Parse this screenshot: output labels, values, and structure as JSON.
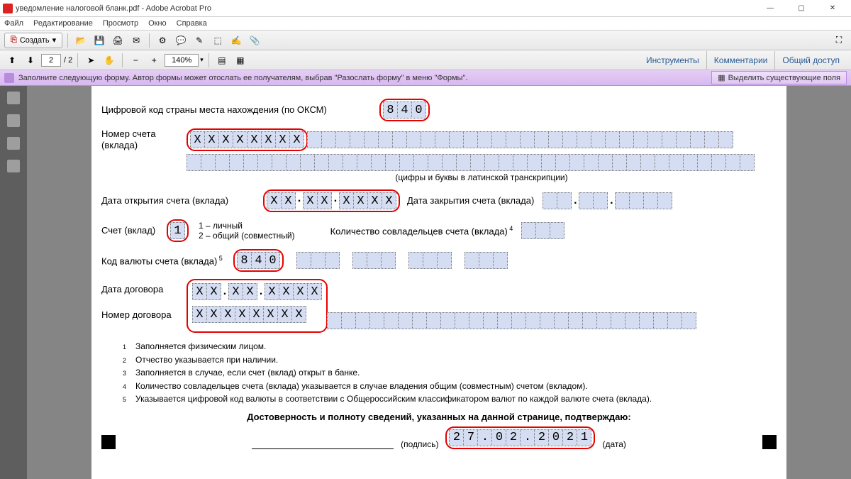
{
  "app": {
    "title": "уведомление налоговой бланк.pdf - Adobe Acrobat Pro"
  },
  "menu": {
    "file": "Файл",
    "edit": "Редактирование",
    "view": "Просмотр",
    "window": "Окно",
    "help": "Справка"
  },
  "toolbar": {
    "create": "Создать"
  },
  "nav": {
    "page": "2",
    "total": "/ 2",
    "zoom": "140%"
  },
  "panels": {
    "tools": "Инструменты",
    "comments": "Комментарии",
    "share": "Общий доступ"
  },
  "info": {
    "text": "Заполните следующую форму. Автор формы может отослать ее получателям, выбрав \"Разослать форму\" в меню \"Формы\".",
    "highlight": "Выделить существующие поля"
  },
  "form": {
    "country_label": "Цифровой код страны места нахождения (по ОКСМ)",
    "country_code": [
      "8",
      "4",
      "0"
    ],
    "account_label": "Номер счета\n(вклада)",
    "account_num": [
      "X",
      "X",
      "X",
      "X",
      "X",
      "X",
      "X",
      "X"
    ],
    "account_hint": "(цифры и буквы в латинской транскрипции)",
    "open_label": "Дата открытия счета (вклада)",
    "open_date": {
      "d": [
        "X",
        "X"
      ],
      "m": [
        "X",
        "X"
      ],
      "y": [
        "X",
        "X",
        "X",
        "X"
      ]
    },
    "close_label": "Дата закрытия счета (вклада)",
    "type_label": "Счет (вклад)",
    "type_val": "1",
    "type_hint1": "1 – личный",
    "type_hint2": "2 – общий (совместный)",
    "coowners_label": "Количество совладельцев счета (вклада)",
    "currency_label": "Код валюты счета (вклада)",
    "currency_code": [
      "8",
      "4",
      "0"
    ],
    "contract_date_label": "Дата договора",
    "contract_date": {
      "d": [
        "X",
        "X"
      ],
      "m": [
        "X",
        "X"
      ],
      "y": [
        "X",
        "X",
        "X",
        "X"
      ]
    },
    "contract_num_label": "Номер договора",
    "contract_num": [
      "X",
      "X",
      "X",
      "X",
      "X",
      "X",
      "X",
      "X"
    ],
    "note1": "Заполняется физическим лицом.",
    "note2": "Отчество указывается при наличии.",
    "note3": "Заполняется в случае, если счет (вклад) открыт в банке.",
    "note4": "Количество совладельцев счета (вклада) указывается в случае владения общим (совместным) счетом (вкладом).",
    "note5": "Указывается цифровой код валюты в соответствии с Общероссийским классификатором валют по каждой валюте счета (вклада).",
    "confirm": "Достоверность и полноту сведений, указанных на данной странице, подтверждаю:",
    "sig_label": "(подпись)",
    "date_label": "(дата)",
    "sig_date": [
      "2",
      "7",
      ".",
      "0",
      "2",
      ".",
      "2",
      "0",
      "2",
      "1"
    ]
  }
}
